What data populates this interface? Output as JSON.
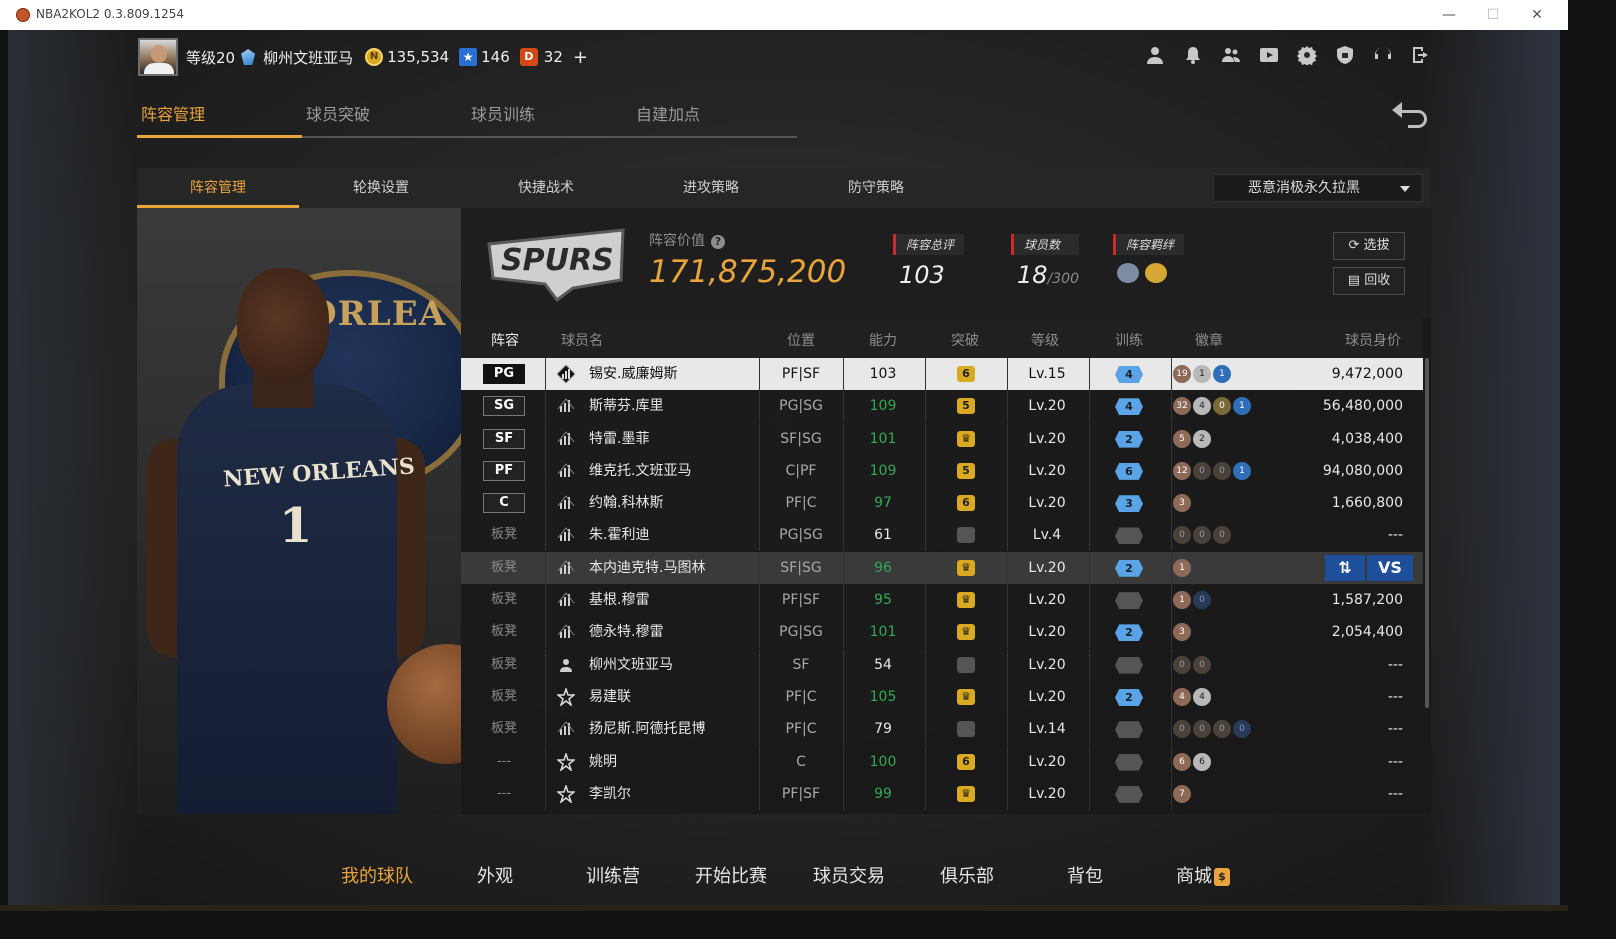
{
  "window": {
    "title": "NBA2KOL2 0.3.809.1254"
  },
  "header": {
    "level": "等级20",
    "team_name": "柳州文班亚马",
    "coins": "135,534",
    "stars": "146",
    "d_points": "32",
    "plus": "+"
  },
  "main_tabs": [
    "阵容管理",
    "球员突破",
    "球员训练",
    "自建加点"
  ],
  "sub_tabs": [
    "阵容管理",
    "轮换设置",
    "快捷战术",
    "进攻策略",
    "防守策略"
  ],
  "dropdown": {
    "selected": "恶意消极永久拉黑"
  },
  "info": {
    "value_label": "阵容价值",
    "value": "171,875,200",
    "rating_label": "阵容总评",
    "rating": "103",
    "players_label": "球员数",
    "players_count": "18",
    "players_max": "/300",
    "bond_label": "阵容羁绊",
    "btn_select": "选拔",
    "btn_recycle": "回收"
  },
  "table_headers": [
    "阵容",
    "球员名",
    "位置",
    "能力",
    "突破",
    "等级",
    "训练",
    "徽章",
    "球员身价"
  ],
  "rows": [
    {
      "slot": "PG",
      "slot_type": "badge",
      "name": "锡安.威廉姆斯",
      "pos": "PF|SF",
      "ability": "103",
      "ability_green": false,
      "breakthrough": "6",
      "level": "Lv.15",
      "train": "4",
      "badges": [
        [
          "19",
          "b-bronze"
        ],
        [
          "1",
          "b-silver"
        ],
        [
          "1",
          "b-blue"
        ]
      ],
      "price": "9,472,000",
      "state": "sel",
      "card": "diamond"
    },
    {
      "slot": "SG",
      "slot_type": "badge",
      "name": "斯蒂芬.库里",
      "pos": "PG|SG",
      "ability": "109",
      "ability_green": true,
      "breakthrough": "5",
      "level": "Lv.20",
      "train": "4",
      "badges": [
        [
          "32",
          "b-bronze"
        ],
        [
          "4",
          "b-silver"
        ],
        [
          "0",
          "b-gold"
        ],
        [
          "1",
          "b-blue"
        ]
      ],
      "price": "56,480,000",
      "state": "",
      "card": "bars"
    },
    {
      "slot": "SF",
      "slot_type": "badge",
      "name": "特雷.墨菲",
      "pos": "SF|SG",
      "ability": "101",
      "ability_green": true,
      "breakthrough": "♛",
      "level": "Lv.20",
      "train": "2",
      "badges": [
        [
          "5",
          "b-bronze"
        ],
        [
          "2",
          "b-silver"
        ]
      ],
      "price": "4,038,400",
      "state": "",
      "card": "bars"
    },
    {
      "slot": "PF",
      "slot_type": "badge",
      "name": "维克托.文班亚马",
      "pos": "C|PF",
      "ability": "109",
      "ability_green": true,
      "breakthrough": "5",
      "level": "Lv.20",
      "train": "6",
      "badges": [
        [
          "12",
          "b-bronze"
        ],
        [
          "0",
          "b-dark"
        ],
        [
          "0",
          "b-dark"
        ],
        [
          "1",
          "b-blue"
        ]
      ],
      "price": "94,080,000",
      "state": "",
      "card": "bars"
    },
    {
      "slot": "C",
      "slot_type": "badge",
      "name": "约翰.科林斯",
      "pos": "PF|C",
      "ability": "97",
      "ability_green": true,
      "breakthrough": "6",
      "level": "Lv.20",
      "train": "3",
      "badges": [
        [
          "3",
          "b-bronze"
        ]
      ],
      "price": "1,660,800",
      "state": "",
      "card": "bars"
    },
    {
      "slot": "板凳",
      "slot_type": "text",
      "name": "朱.霍利迪",
      "pos": "PG|SG",
      "ability": "61",
      "ability_green": false,
      "breakthrough": "",
      "level": "Lv.4",
      "train": "",
      "badges": [
        [
          "0",
          "b-dark"
        ],
        [
          "0",
          "b-dark"
        ],
        [
          "0",
          "b-dark"
        ]
      ],
      "price": "---",
      "state": "",
      "card": "bars"
    },
    {
      "slot": "板凳",
      "slot_type": "text",
      "name": "本内迪克特.马图林",
      "pos": "SF|SG",
      "ability": "96",
      "ability_green": true,
      "breakthrough": "♛",
      "level": "Lv.20",
      "train": "2",
      "badges": [
        [
          "1",
          "b-bronze"
        ]
      ],
      "price": "",
      "state": "hl",
      "card": "bars",
      "actions": true
    },
    {
      "slot": "板凳",
      "slot_type": "text",
      "name": "基根.穆雷",
      "pos": "PF|SF",
      "ability": "95",
      "ability_green": true,
      "breakthrough": "♛",
      "level": "Lv.20",
      "train": "",
      "badges": [
        [
          "1",
          "b-bronze"
        ],
        [
          "0",
          "b-navy"
        ]
      ],
      "price": "1,587,200",
      "state": "",
      "card": "bars"
    },
    {
      "slot": "板凳",
      "slot_type": "text",
      "name": "德永特.穆雷",
      "pos": "PG|SG",
      "ability": "101",
      "ability_green": true,
      "breakthrough": "♛",
      "level": "Lv.20",
      "train": "2",
      "badges": [
        [
          "3",
          "b-bronze"
        ]
      ],
      "price": "2,054,400",
      "state": "",
      "card": "bars"
    },
    {
      "slot": "板凳",
      "slot_type": "text",
      "name": "柳州文班亚马",
      "pos": "SF",
      "ability": "54",
      "ability_green": false,
      "breakthrough": "",
      "level": "Lv.20",
      "train": "",
      "badges": [
        [
          "0",
          "b-dark"
        ],
        [
          "0",
          "b-dark"
        ]
      ],
      "price": "---",
      "state": "",
      "card": "user"
    },
    {
      "slot": "板凳",
      "slot_type": "text",
      "name": "易建联",
      "pos": "PF|C",
      "ability": "105",
      "ability_green": true,
      "breakthrough": "♛",
      "level": "Lv.20",
      "train": "2",
      "badges": [
        [
          "4",
          "b-bronze"
        ],
        [
          "4",
          "b-silver"
        ]
      ],
      "price": "---",
      "state": "",
      "card": "star"
    },
    {
      "slot": "板凳",
      "slot_type": "text",
      "name": "扬尼斯.阿德托昆博",
      "pos": "PF|C",
      "ability": "79",
      "ability_green": false,
      "breakthrough": "",
      "level": "Lv.14",
      "train": "",
      "badges": [
        [
          "0",
          "b-dark"
        ],
        [
          "0",
          "b-dark"
        ],
        [
          "0",
          "b-dark"
        ],
        [
          "0",
          "b-navy"
        ]
      ],
      "price": "---",
      "state": "",
      "card": "bars"
    },
    {
      "slot": "---",
      "slot_type": "text",
      "name": "姚明",
      "pos": "C",
      "ability": "100",
      "ability_green": true,
      "breakthrough": "6",
      "level": "Lv.20",
      "train": "",
      "badges": [
        [
          "6",
          "b-bronze"
        ],
        [
          "6",
          "b-silver"
        ]
      ],
      "price": "---",
      "state": "",
      "card": "star"
    },
    {
      "slot": "---",
      "slot_type": "text",
      "name": "李凯尔",
      "pos": "PF|SF",
      "ability": "99",
      "ability_green": true,
      "breakthrough": "♛",
      "level": "Lv.20",
      "train": "",
      "badges": [
        [
          "7",
          "b-bronze"
        ]
      ],
      "price": "---",
      "state": "",
      "card": "star"
    }
  ],
  "row_actions": {
    "vs": "VS"
  },
  "bottom_nav": [
    "我的球队",
    "外观",
    "训练营",
    "开始比赛",
    "球员交易",
    "俱乐部",
    "背包",
    "商城"
  ],
  "colors": {
    "accent": "#e9a43c",
    "selected_row": "#e8e8e8",
    "ability_green": "#34a853"
  }
}
